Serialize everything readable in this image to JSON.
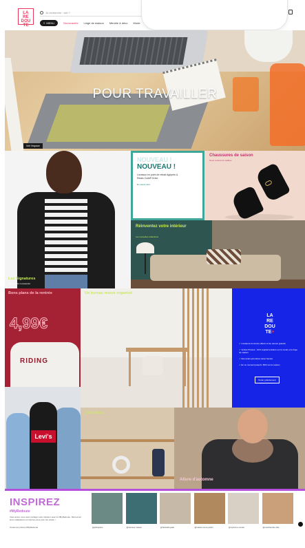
{
  "header": {
    "logo": [
      "LA",
      "RE",
      "DOU",
      "TE"
    ],
    "search_placeholder": "Je recherche : ciel ?",
    "menu_label": "MENU",
    "nav": [
      "Nouveautés",
      "Linge de maison",
      "Meuble & déco",
      "Mode",
      "Enfant"
    ]
  },
  "hero": {
    "title": "POUR TRAVAILLER",
    "cta": "Voir l'espace"
  },
  "tiles": {
    "jacket": {
      "label": "Les Signatures",
      "sub": "Voir plus de nouveautés"
    },
    "new": {
      "ghost": "NOUVEAU !",
      "title": "NOUVEAU !",
      "desc": "Livraison en point de retrait Agriprès & Relais Colis® Drive.",
      "more": "En savoir plus"
    },
    "shoes": {
      "label": "Chaussures de saison",
      "sub": "Nous voulons le meilleur"
    },
    "interior": {
      "label": "Réinventez votre intérieur",
      "sub": "Les nouvelles collections"
    },
    "deals": {
      "label": "Bons plans de la rentrée",
      "price": "4,99€",
      "sweat_text": "RIDING"
    },
    "office": {
      "label": "Un bureau mieux organisé"
    },
    "redoute_plus": {
      "logo": [
        "LA",
        "RE",
        "DOU",
        "TE"
      ],
      "plus": "+",
      "benefits": [
        "Livraisons & retours offerts et les retours gratuits",
        "Ventes Privées : 10% supplémentaires sur la mode et le linge de maison",
        "Des avant-premières toute l'année",
        "En ce moment jusqu'à -50% sur la maison"
      ],
      "button": "Tenter gratuitement"
    },
    "jeans": {
      "logo": "Levi's"
    },
    "deco": {
      "label": "Côté déco"
    },
    "autumn": {
      "label": "Allure d'automne"
    }
  },
  "inspire": {
    "title": "INSPIREZ",
    "tag": "#MyRedoute",
    "desc": "Vous aussi, vous avez partagé votre intérieur avec le #MyRedoute. Découvrez leurs réalisations et inspirez-vous pour les vôtres !",
    "link": "Toutes les photos #MyRedoute",
    "thumbs": [
      {
        "cap": "@jolicapture",
        "color": "#6b8a86"
      },
      {
        "cap": "@interieur.maison",
        "color": "#3d6e74"
      },
      {
        "cap": "@hannahsyweb",
        "color": "#c7b9a8"
      },
      {
        "cap": "@maison.sur.le.jardin",
        "color": "#b08a5e"
      },
      {
        "cap": "@myhome.monde",
        "color": "#d8d0c4"
      },
      {
        "cap": "@unechambre.ville",
        "color": "#c9a07a"
      }
    ]
  }
}
